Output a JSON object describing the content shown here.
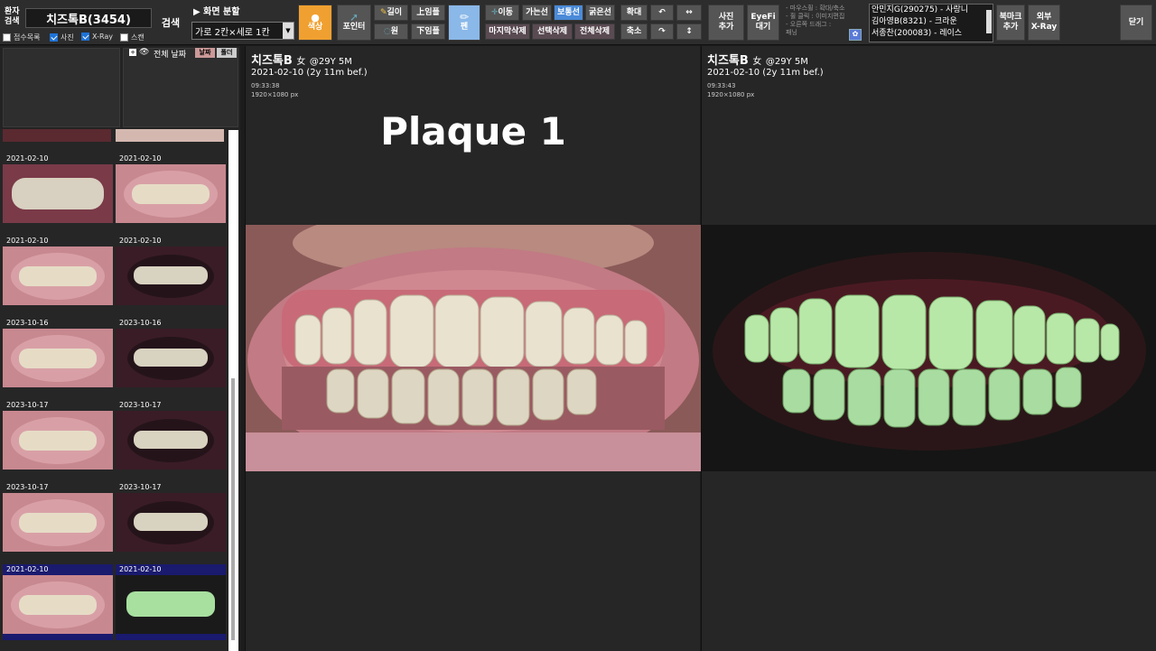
{
  "toolbar": {
    "patient_search_label": "환자\n검색",
    "patient_name": "치즈톡B(3454)",
    "search_label": "검색",
    "checks": [
      {
        "label": "접수목록",
        "on": false
      },
      {
        "label": "사진",
        "on": true
      },
      {
        "label": "X-Ray",
        "on": true
      },
      {
        "label": "스캔",
        "on": false
      }
    ],
    "split_label": "▶ 화면 분할",
    "split_value": "가로 2칸×세로 1칸",
    "color_label": "색상",
    "pointer_label": "포인터",
    "length_label": "길이",
    "circle_label": "원",
    "upper_label": "上임플",
    "lower_label": "下임플",
    "pen_label": "펜",
    "move_label": "이동",
    "thin_line": "가는선",
    "normal_line": "보통선",
    "thick_line": "굵은선",
    "delete_last": "마지막삭제",
    "delete_selected": "선택삭제",
    "delete_all": "전체삭제",
    "zoom_in": "확대",
    "zoom_out": "축소",
    "add_photo": "사진\n추가",
    "eyefi_wait": "EyeFi\n대기",
    "hint_lines": [
      "- 마우스휠 : 확대/축소",
      "- 휠 클릭 : 이미지편집",
      "- 오른쪽 드래그 : ",
      "패닝"
    ],
    "waiting_list": [
      "안민지G(290275) - 사랑니",
      "김아영B(8321) - 크라운",
      "서종찬(200083) - 레이스"
    ],
    "bookmark_add": "북마크\n추가",
    "external_xray": "외부\nX-Ray",
    "close_label": "닫기"
  },
  "sidebar": {
    "all_label": "전체 날짜",
    "date_btn": "날짜",
    "folder_btn": "폴더",
    "thumbs": [
      {
        "date": "2021-02-10",
        "type": "white"
      },
      {
        "date": "2021-02-10",
        "type": "natural"
      },
      {
        "date": "2021-02-10",
        "type": "natural"
      },
      {
        "date": "2021-02-10",
        "type": "dark"
      },
      {
        "date": "2023-10-16",
        "type": "natural"
      },
      {
        "date": "2023-10-16",
        "type": "dark"
      },
      {
        "date": "2023-10-17",
        "type": "natural"
      },
      {
        "date": "2023-10-17",
        "type": "dark"
      },
      {
        "date": "2023-10-17",
        "type": "natural"
      },
      {
        "date": "2023-10-17",
        "type": "dark"
      },
      {
        "date": "2021-02-10",
        "type": "natural"
      },
      {
        "date": "2021-02-10",
        "type": "fluor"
      }
    ]
  },
  "left_pane": {
    "name": "치즈톡B",
    "gender": "女",
    "age": "@29Y 5M",
    "date": "2021-02-10 (2y 11m bef.)",
    "time": "09:33:38",
    "size": "1920×1080 px",
    "caption": "Plaque 1"
  },
  "right_pane": {
    "name": "치즈톡B",
    "gender": "女",
    "age": "@29Y 5M",
    "date": "2021-02-10 (2y 11m bef.)",
    "time": "09:33:43",
    "size": "1920×1080 px"
  },
  "colors": {
    "selected_tab": "#1a1a6e",
    "orange": "#f0a030",
    "blue": "#3a7bd5"
  }
}
